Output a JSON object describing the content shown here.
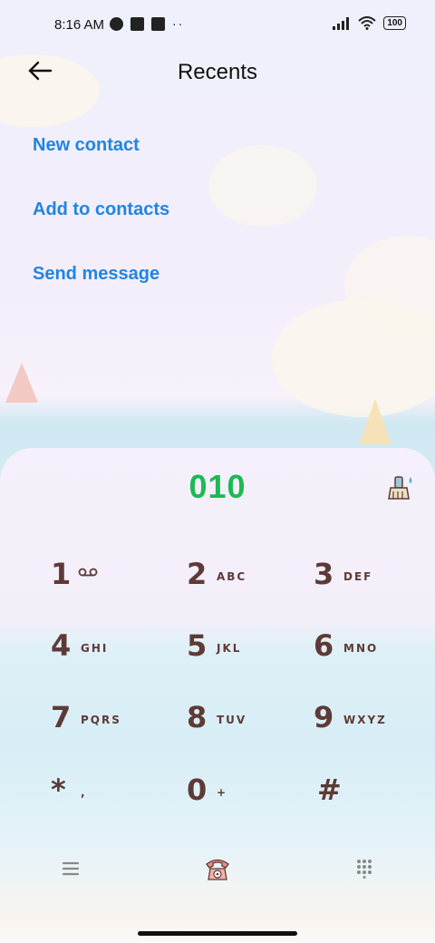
{
  "status_bar": {
    "time": "8:16 AM",
    "battery": "100"
  },
  "header": {
    "title": "Recents"
  },
  "actions": {
    "new_contact": "New contact",
    "add_to_contacts": "Add to contacts",
    "send_message": "Send message"
  },
  "dialer": {
    "number": "010",
    "keys": [
      {
        "digit": "1",
        "letters": ""
      },
      {
        "digit": "2",
        "letters": "ABC"
      },
      {
        "digit": "3",
        "letters": "DEF"
      },
      {
        "digit": "4",
        "letters": "GHI"
      },
      {
        "digit": "5",
        "letters": "JKL"
      },
      {
        "digit": "6",
        "letters": "MNO"
      },
      {
        "digit": "7",
        "letters": "PQRS"
      },
      {
        "digit": "8",
        "letters": "TUV"
      },
      {
        "digit": "9",
        "letters": "WXYZ"
      },
      {
        "digit": "*",
        "letters": ","
      },
      {
        "digit": "0",
        "letters": "+"
      },
      {
        "digit": "#",
        "letters": ""
      }
    ]
  },
  "colors": {
    "number": "#1db954",
    "link": "#2284e0",
    "key": "#5e3a36"
  },
  "icons": {
    "menu": "hamburger-icon",
    "call": "telephone-icon",
    "keypad": "keypad-icon",
    "clear": "brush-icon",
    "voicemail": "voicemail-icon"
  }
}
